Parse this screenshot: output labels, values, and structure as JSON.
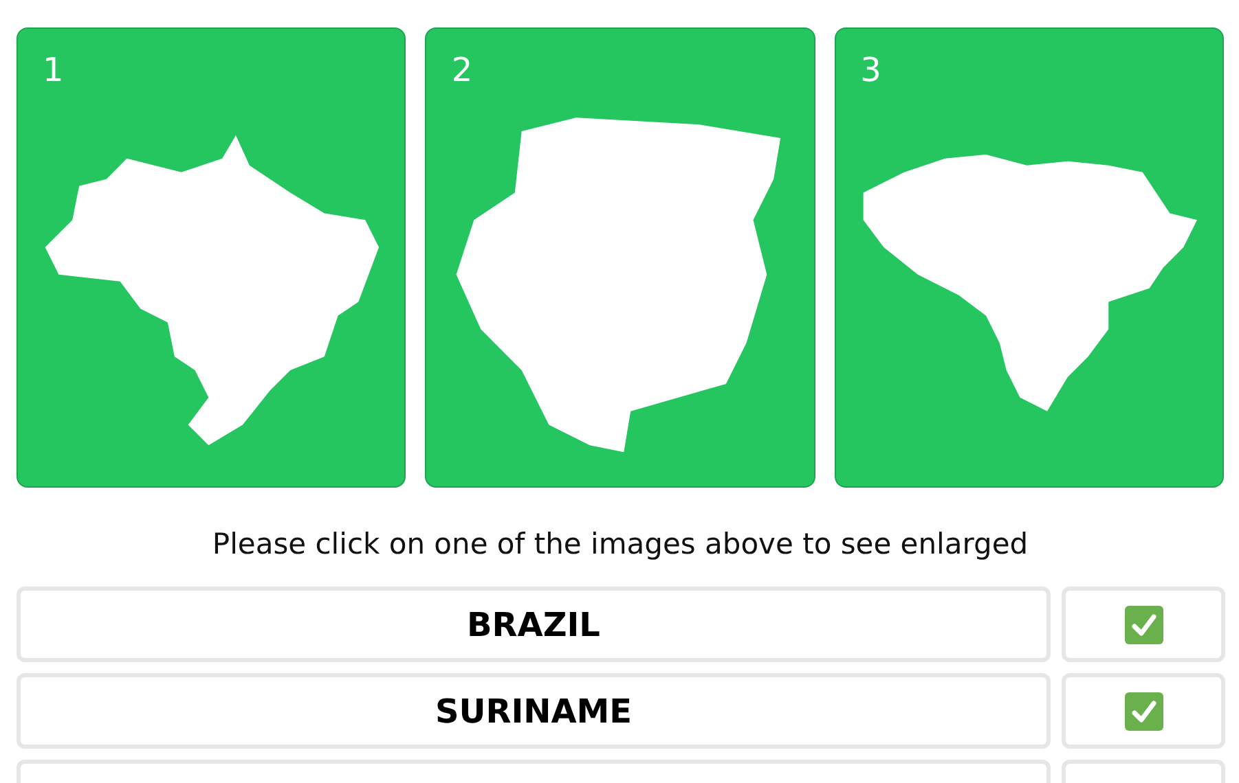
{
  "cards": [
    {
      "number": "1",
      "kind": "brazil"
    },
    {
      "number": "2",
      "kind": "suriname"
    },
    {
      "number": "3",
      "kind": "venezuela"
    }
  ],
  "prompt": "Please click on one of the images above to see enlarged",
  "answers": [
    {
      "label": "BRAZIL",
      "correct": true
    },
    {
      "label": "SURINAME",
      "correct": true
    }
  ]
}
